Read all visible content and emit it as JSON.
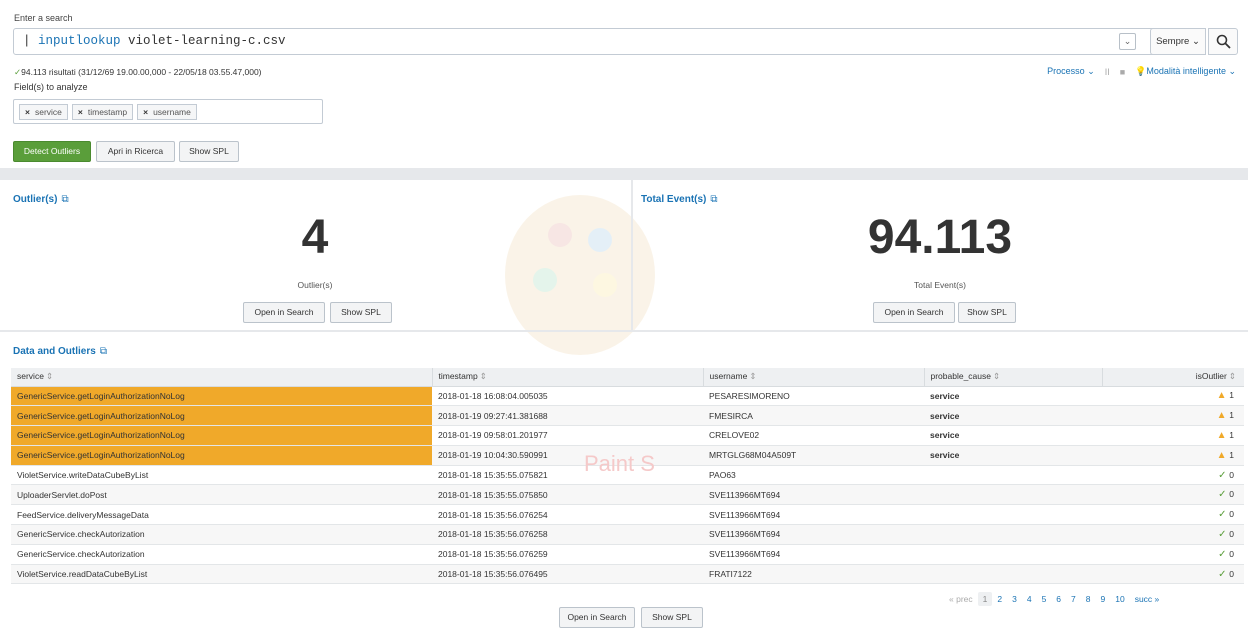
{
  "search": {
    "label": "Enter a search",
    "prefix": "| ",
    "command": "inputlookup",
    "argument": " violet-learning-c.csv",
    "time_range": "Sempre",
    "time_caret": "⌄"
  },
  "status": {
    "check": "✓",
    "results": "94.113 risultati (31/12/69 19.00.00,000 - 22/05/18 03.55.47,000)",
    "process": "Processo ⌄",
    "mode": "Modalità intelligente ⌄",
    "pause": "II",
    "stop": "■"
  },
  "fields": {
    "label": "Field(s) to analyze",
    "chips": [
      "service",
      "timestamp",
      "username"
    ]
  },
  "actions": {
    "detect": "Detect Outliers",
    "open_search": "Apri in Ricerca",
    "show_spl": "Show SPL"
  },
  "outliers_panel": {
    "title": "Outlier(s)",
    "value": "4",
    "caption": "Outlier(s)",
    "open": "Open in Search",
    "spl": "Show SPL"
  },
  "events_panel": {
    "title": "Total Event(s)",
    "value": "94.113",
    "caption": "Total Event(s)",
    "open": "Open in Search",
    "spl": "Show SPL"
  },
  "table": {
    "title": "Data and Outliers",
    "columns": [
      "service",
      "timestamp",
      "username",
      "probable_cause",
      "isOutlier"
    ],
    "rows": [
      {
        "service": "GenericService.getLoginAuthorizationNoLog",
        "timestamp": "2018-01-18 16:08:04.005035",
        "username": "PESARESIMORENO",
        "cause": "service",
        "out": "1",
        "outlier": true
      },
      {
        "service": "GenericService.getLoginAuthorizationNoLog",
        "timestamp": "2018-01-19 09:27:41.381688",
        "username": "FMESIRCA",
        "cause": "service",
        "out": "1",
        "outlier": true
      },
      {
        "service": "GenericService.getLoginAuthorizationNoLog",
        "timestamp": "2018-01-19 09:58:01.201977",
        "username": "CRELOVE02",
        "cause": "service",
        "out": "1",
        "outlier": true
      },
      {
        "service": "GenericService.getLoginAuthorizationNoLog",
        "timestamp": "2018-01-19 10:04:30.590991",
        "username": "MRTGLG68M04A509T",
        "cause": "service",
        "out": "1",
        "outlier": true
      },
      {
        "service": "VioletService.writeDataCubeByList",
        "timestamp": "2018-01-18 15:35:55.075821",
        "username": "PAO63",
        "cause": "",
        "out": "0",
        "outlier": false
      },
      {
        "service": "UploaderServlet.doPost",
        "timestamp": "2018-01-18 15:35:55.075850",
        "username": "SVE113966MT694",
        "cause": "",
        "out": "0",
        "outlier": false
      },
      {
        "service": "FeedService.deliveryMessageData",
        "timestamp": "2018-01-18 15:35:56.076254",
        "username": "SVE113966MT694",
        "cause": "",
        "out": "0",
        "outlier": false
      },
      {
        "service": "GenericService.checkAutorization",
        "timestamp": "2018-01-18 15:35:56.076258",
        "username": "SVE113966MT694",
        "cause": "",
        "out": "0",
        "outlier": false
      },
      {
        "service": "GenericService.checkAutorization",
        "timestamp": "2018-01-18 15:35:56.076259",
        "username": "SVE113966MT694",
        "cause": "",
        "out": "0",
        "outlier": false
      },
      {
        "service": "VioletService.readDataCubeByList",
        "timestamp": "2018-01-18 15:35:56.076495",
        "username": "FRATI7122",
        "cause": "",
        "out": "0",
        "outlier": false
      }
    ],
    "open": "Open in Search",
    "spl": "Show SPL"
  },
  "pager": {
    "prev": "« prec",
    "pages": [
      "1",
      "2",
      "3",
      "4",
      "5",
      "6",
      "7",
      "8",
      "9",
      "10"
    ],
    "next": "succ »"
  },
  "watermark": "Paint S",
  "colors": {
    "accent": "#1a73b4",
    "success": "#5a9e3a",
    "outlier_highlight": "#f0a92a"
  }
}
